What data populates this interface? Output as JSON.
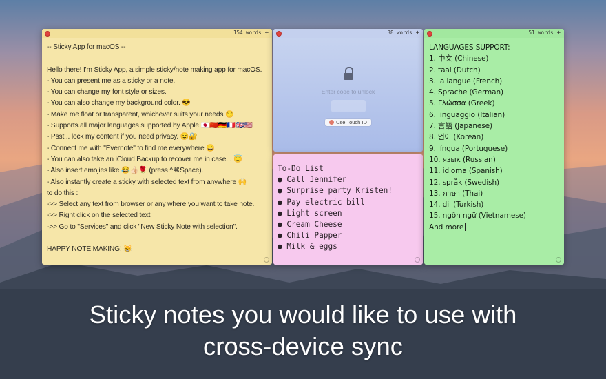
{
  "yellow_note": {
    "word_count": "154 words",
    "plus": "+",
    "lines": [
      "-- Sticky App for macOS --",
      "",
      "Hello there! I'm Sticky App, a simple sticky/note making app for macOS.",
      "- You can present me as a sticky or a note.",
      "- You can change my font style or sizes.",
      "- You can also change my background color. 😎",
      "- Make me float or transparent, whichever suits your needs 😏",
      "- Supports all major languages supported by Apple 🇯🇵🇨🇳🇩🇪🇫🇷🇬🇧🇺🇸",
      "- Psst... lock my content if you need privacy. 😉🔐",
      "- Connect me with \"Evernote\" to find me everywhere 😀",
      "- You can also take an iCloud Backup to recover me in case... 😇",
      "- Also insert emojies like 😂👍🏻🌹 (press ^⌘Space).",
      "- Also instantly create a sticky with selected text from anywhere 🙌",
      "to do this :",
      "->> Select any text from browser or any where you want to take note.",
      "->> Right click on the selected text",
      "->> Go to \"Services\" and click \"New Sticky Note with selection\".",
      "",
      "HAPPY NOTE MAKING! 😸"
    ]
  },
  "blue_note": {
    "word_count": "38 words",
    "plus": "+",
    "lock_icon": "lock-icon",
    "unlock_hint": "Enter code to unlock",
    "touch_id_label": "Use Touch ID"
  },
  "pink_note": {
    "title": "To-Do List",
    "items": [
      "● Call Jennifer",
      "● Surprise party Kristen!",
      "● Pay electric bill",
      "● Light screen",
      "● Cream Cheese",
      "● Chili Papper",
      "● Milk & eggs"
    ]
  },
  "green_note": {
    "word_count": "51 words",
    "plus": "+",
    "lines": [
      "LANGUAGES SUPPORT:",
      "1. 中文 (Chinese)",
      "2. taal (Dutch)",
      "3. la langue (French)",
      "4. Sprache (German)",
      "5. Γλώσσα (Greek)",
      "6. linguaggio (Italian)",
      "7. 言語 (Japanese)",
      "8. 언어 (Korean)",
      "9. língua (Portuguese)",
      "10. язык (Russian)",
      "11. idioma (Spanish)",
      "12. språk (Swedish)",
      "13. ภาษา (Thai)",
      "14. dil (Turkish)",
      "15. ngôn ngữ (Vietnamese)",
      "And more"
    ]
  },
  "caption": {
    "line1": "Sticky notes you would like to use with",
    "line2": "cross-device sync"
  },
  "colors": {
    "yellow": "#f6e6a9",
    "blue": "#b8c8ee",
    "pink": "#f7c9ee",
    "green": "#a9eda6",
    "close_button": "#e0443e"
  }
}
